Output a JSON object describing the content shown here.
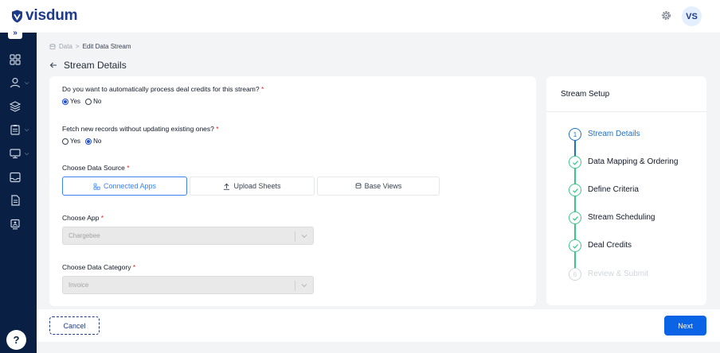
{
  "app": {
    "name": "visdum",
    "user_initials": "VS",
    "help_label": "?"
  },
  "colors": {
    "brand": "#1e3a8a",
    "primary": "#0b63e5",
    "active_step": "#1d72c9",
    "done_step": "#3cc68a",
    "sidebar_bg": "#0a1f44"
  },
  "sidebar": {
    "expand_label": "»",
    "icons": [
      "grid-icon",
      "user-icon",
      "layers-icon",
      "clipboard-icon",
      "monitor-icon",
      "inbox-icon",
      "document-icon",
      "report-icon"
    ]
  },
  "breadcrumb": {
    "root": "Data",
    "separator": ">",
    "current": "Edit Data Stream"
  },
  "page": {
    "title": "Stream Details",
    "back_icon": "arrow-left-icon"
  },
  "form": {
    "q1": {
      "label": "Do you want to automatically process deal credits for this stream?",
      "required": "*",
      "options": [
        "Yes",
        "No"
      ],
      "selected": "Yes"
    },
    "q2": {
      "label": "Fetch new records without updating existing ones?",
      "required": "*",
      "options": [
        "Yes",
        "No"
      ],
      "selected": "No"
    },
    "data_source": {
      "label": "Choose Data Source",
      "required": "*",
      "options": [
        "Connected Apps",
        "Upload Sheets",
        "Base Views"
      ],
      "selected": "Connected Apps"
    },
    "app": {
      "label": "Choose App",
      "required": "*",
      "value": "Chargebee"
    },
    "category": {
      "label": "Choose Data Category",
      "required": "*",
      "value": "Invoice"
    }
  },
  "setup": {
    "title": "Stream Setup",
    "steps": [
      {
        "label": "Stream Details",
        "state": "active",
        "number": "1"
      },
      {
        "label": "Data Mapping & Ordering",
        "state": "done"
      },
      {
        "label": "Define Criteria",
        "state": "done"
      },
      {
        "label": "Stream Scheduling",
        "state": "done"
      },
      {
        "label": "Deal Credits",
        "state": "done"
      },
      {
        "label": "Review & Submit",
        "state": "pending",
        "number": "6"
      }
    ]
  },
  "footer": {
    "cancel_label": "Cancel",
    "next_label": "Next"
  }
}
